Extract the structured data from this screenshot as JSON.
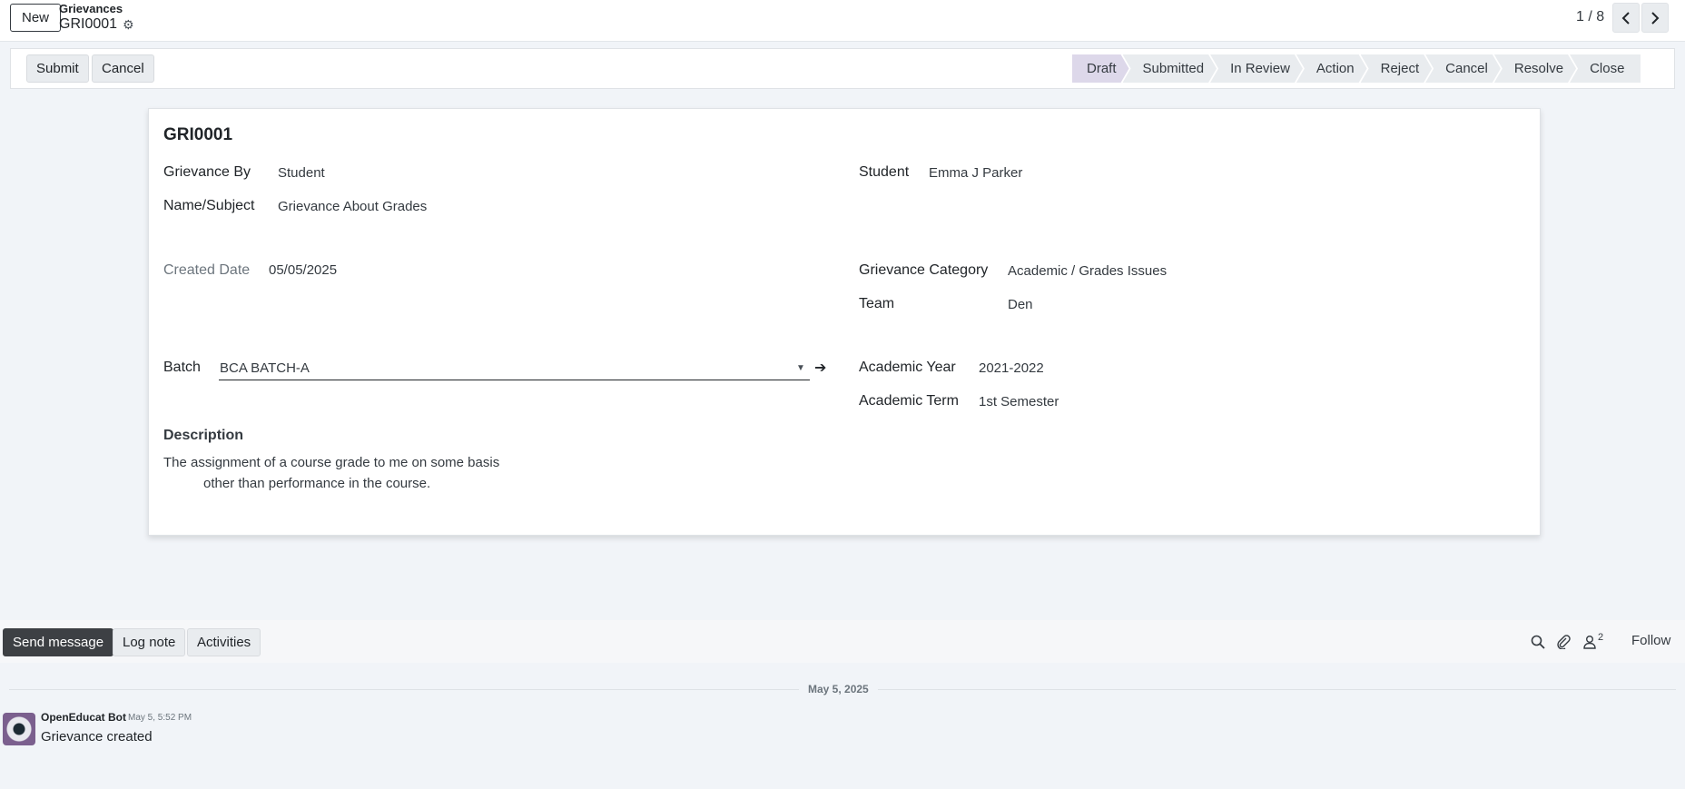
{
  "control_panel": {
    "new_label": "New",
    "breadcrumb_parent": "Grievances",
    "breadcrumb_current": "GRI0001",
    "pager_value": "1 / 8"
  },
  "statusbar": {
    "submit_label": "Submit",
    "cancel_label": "Cancel",
    "active_stage": "Draft",
    "stages": [
      "Draft",
      "Submitted",
      "In Review",
      "Action",
      "Reject",
      "Cancel",
      "Resolve",
      "Close"
    ]
  },
  "form": {
    "title": "GRI0001",
    "grievance_by_label": "Grievance By",
    "grievance_by_value": "Student",
    "name_subject_label": "Name/Subject",
    "name_subject_value": "Grievance About Grades",
    "student_label": "Student",
    "student_value": "Emma J Parker",
    "created_date_label": "Created Date",
    "created_date_value": "05/05/2025",
    "category_label": "Grievance Category",
    "category_value": "Academic / Grades Issues",
    "team_label": "Team",
    "team_value": "Den",
    "batch_label": "Batch",
    "batch_value": "BCA BATCH-A",
    "academic_year_label": "Academic Year",
    "academic_year_value": "2021-2022",
    "academic_term_label": "Academic Term",
    "academic_term_value": "1st Semester",
    "description_label": "Description",
    "description_line1": "The assignment of a course grade to me on some basis",
    "description_line2": "other than performance in the course."
  },
  "chatter": {
    "send_message_label": "Send message",
    "log_note_label": "Log note",
    "activities_label": "Activities",
    "follower_count": "2",
    "follow_label": "Follow",
    "date_separator": "May 5, 2025",
    "messages": [
      {
        "author": "OpenEducat Bot",
        "date": "May 5, 5:52 PM",
        "body": "Grievance created"
      }
    ]
  },
  "icons": {
    "gear": "gear-icon",
    "prev": "chevron-left-icon",
    "next": "chevron-right-icon",
    "search": "search-icon",
    "attachment": "paperclip-icon",
    "followers": "user-icon",
    "internal_link": "arrow-right-icon"
  }
}
